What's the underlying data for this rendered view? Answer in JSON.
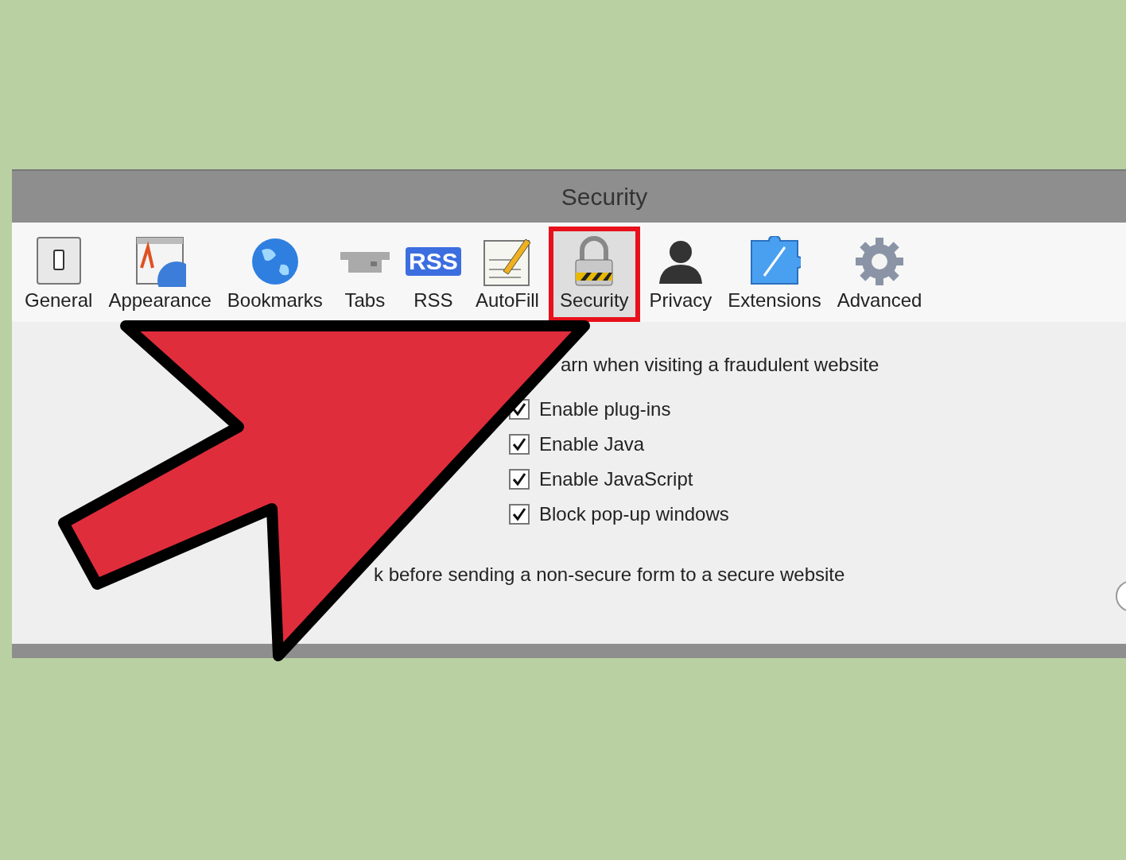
{
  "window": {
    "title": "Security"
  },
  "toolbar": [
    {
      "kind": "general",
      "label": "General",
      "selected": false
    },
    {
      "kind": "appearance",
      "label": "Appearance",
      "selected": false
    },
    {
      "kind": "bookmarks",
      "label": "Bookmarks",
      "selected": false
    },
    {
      "kind": "tabs",
      "label": "Tabs",
      "selected": false
    },
    {
      "kind": "rss",
      "label": "RSS",
      "icon_text": "RSS",
      "selected": false
    },
    {
      "kind": "autofill",
      "label": "AutoFill",
      "selected": false
    },
    {
      "kind": "security",
      "label": "Security",
      "selected": true
    },
    {
      "kind": "privacy",
      "label": "Privacy",
      "selected": false
    },
    {
      "kind": "extensions",
      "label": "Extensions",
      "selected": false
    },
    {
      "kind": "advanced",
      "label": "Advanced",
      "selected": false
    }
  ],
  "settings": [
    {
      "kind": "top_line",
      "text": "arn when visiting a fraudulent website"
    },
    {
      "kind": "checkbox",
      "text": "Enable plug-ins",
      "checked": true
    },
    {
      "kind": "checkbox",
      "text": "Enable Java",
      "checked": true
    },
    {
      "kind": "checkbox",
      "text": "Enable JavaScript",
      "checked": true
    },
    {
      "kind": "checkbox",
      "text": "Block pop-up windows",
      "checked": true
    },
    {
      "kind": "bottom_line",
      "text": "k before sending a non-secure form to a secure website"
    }
  ]
}
